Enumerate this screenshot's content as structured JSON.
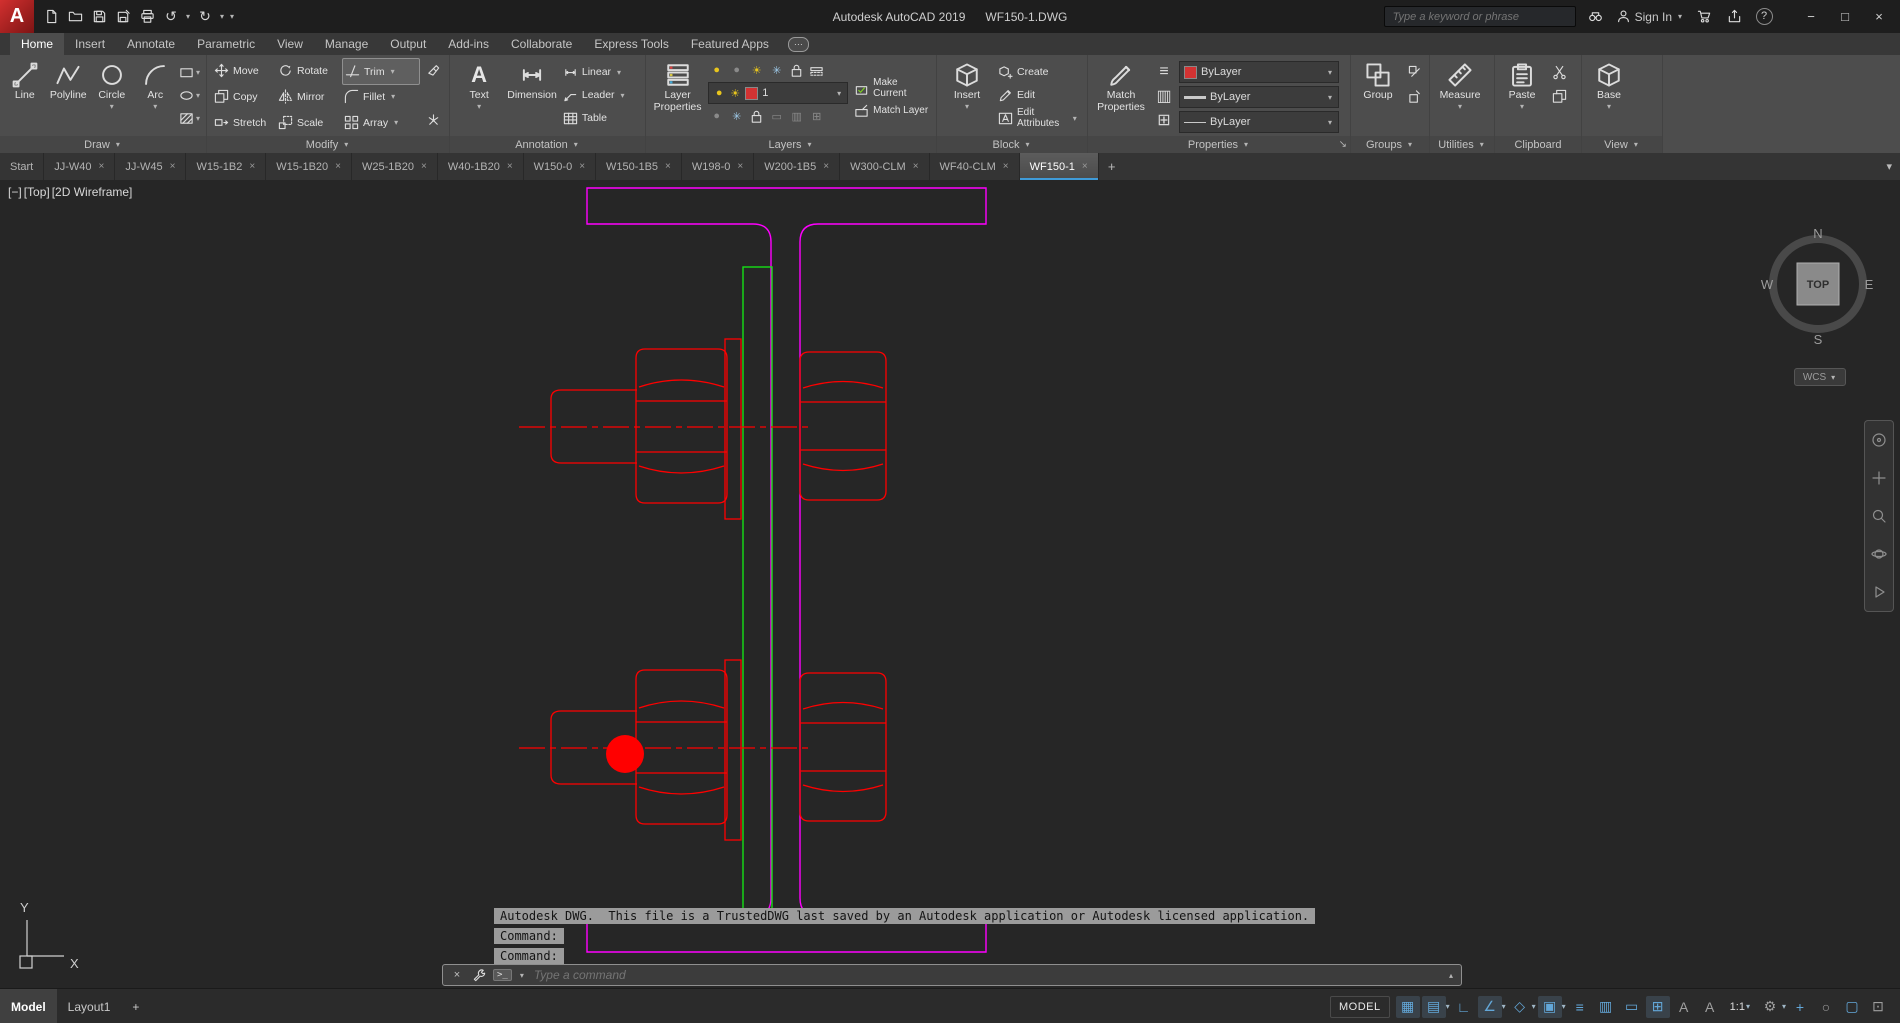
{
  "titlebar": {
    "app_name": "Autodesk AutoCAD 2019",
    "doc_name": "WF150-1.DWG",
    "search_placeholder": "Type a keyword or phrase",
    "sign_in_label": "Sign In"
  },
  "ribbon_tabs": [
    "Home",
    "Insert",
    "Annotate",
    "Parametric",
    "View",
    "Manage",
    "Output",
    "Add-ins",
    "Collaborate",
    "Express Tools",
    "Featured Apps"
  ],
  "panels": {
    "draw": {
      "label": "Draw",
      "line": "Line",
      "polyline": "Polyline",
      "circle": "Circle",
      "arc": "Arc"
    },
    "modify": {
      "label": "Modify",
      "move": "Move",
      "rotate": "Rotate",
      "trim": "Trim",
      "copy": "Copy",
      "mirror": "Mirror",
      "fillet": "Fillet",
      "stretch": "Stretch",
      "scale": "Scale",
      "array": "Array"
    },
    "annotation": {
      "label": "Annotation",
      "text": "Text",
      "dimension": "Dimension",
      "linear": "Linear",
      "leader": "Leader",
      "table": "Table"
    },
    "layers": {
      "label": "Layers",
      "layer_properties": "Layer Properties",
      "make_current": "Make Current",
      "match_layer": "Match Layer",
      "current_layer": "1"
    },
    "block": {
      "label": "Block",
      "insert": "Insert",
      "create": "Create",
      "edit": "Edit",
      "edit_attributes": "Edit Attributes"
    },
    "properties": {
      "label": "Properties",
      "match_properties": "Match Properties",
      "color": "ByLayer",
      "lineweight": "ByLayer",
      "linetype": "ByLayer"
    },
    "groups": {
      "label": "Groups",
      "group": "Group"
    },
    "utilities": {
      "label": "Utilities",
      "measure": "Measure"
    },
    "clipboard": {
      "label": "Clipboard",
      "paste": "Paste"
    },
    "view": {
      "label": "View",
      "base": "Base"
    }
  },
  "file_tabs": [
    "Start",
    "JJ-W40",
    "JJ-W45",
    "W15-1B2",
    "W15-1B20",
    "W25-1B20",
    "W40-1B20",
    "W150-0",
    "W150-1B5",
    "W198-0",
    "W200-1B5",
    "W300-CLM",
    "WF40-CLM",
    "WF150-1"
  ],
  "viewport": {
    "minus_control": "[−]",
    "view_control": "[Top]",
    "style_control": "[2D Wireframe]",
    "viewcube": {
      "n": "N",
      "s": "S",
      "e": "E",
      "w": "W",
      "face": "TOP",
      "wcs": "WCS"
    },
    "trusted_message": "Autodesk DWG.  This file is a TrustedDWG last saved by an Autodesk application or Autodesk licensed application.",
    "history": [
      "Command:",
      "Command:"
    ],
    "command_placeholder": "Type a command",
    "ucs": {
      "x": "X",
      "y": "Y"
    }
  },
  "statusbar": {
    "model_tab": "Model",
    "layout_tab": "Layout1",
    "add_layout": "+",
    "model_space": "MODEL",
    "scale": "1:1"
  },
  "icons": {
    "dropdown": "▾",
    "up": "▴",
    "overflow": "»",
    "launcher": "↘",
    "dots": "···",
    "close": "×",
    "minimize": "−",
    "maximize": "□",
    "help": "?",
    "undo": "↺",
    "redo": "↻",
    "plus": "+",
    "prompt": ">_",
    "sun": "☀",
    "snow": "✳",
    "bulb": "●",
    "gear": "⚙",
    "grid": "▦",
    "snap": "▤",
    "ortho": "∟",
    "polar": "∠",
    "isodraft": "◇",
    "osnap": "▣",
    "lineweight": "≡",
    "transparency": "▥",
    "selection": "▭",
    "dyn_input": "⊞",
    "annot_a": "A",
    "isolate": "○",
    "graphics": "▢",
    "clean": "⊡"
  },
  "colors": {
    "entity_red": "#ff0000",
    "entity_magenta": "#ff00ff",
    "entity_green": "#15e015",
    "layer_swatch": "#d23232",
    "status_icon_blue": "#63a7d8"
  }
}
